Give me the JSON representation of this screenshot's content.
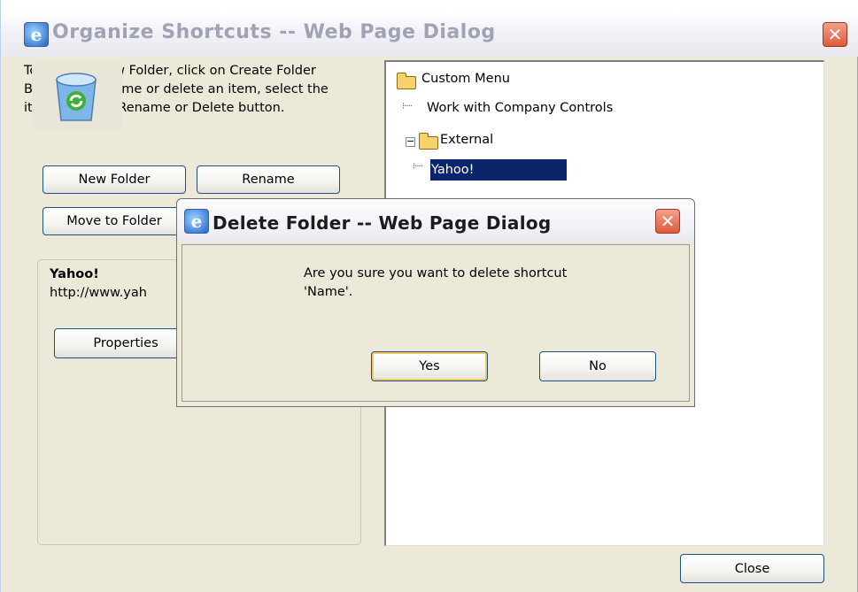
{
  "main_window": {
    "title": "Organize Shortcuts -- Web Page Dialog",
    "instructions": "To create a new Folder, click on Create Folder Button. To rename or delete an item, select the item and click Rename or Delete button.",
    "buttons": {
      "new_folder": "New Folder",
      "rename": "Rename",
      "move_to_folder": "Move to Folder",
      "properties": "Properties",
      "close": "Close"
    },
    "selected_info": {
      "name": "Yahoo!",
      "url": "http://www.yah"
    },
    "tree": {
      "root": "Custom Menu",
      "items": [
        "Work with Company Controls",
        "External",
        "Yahoo!"
      ],
      "selected": "Yahoo!"
    }
  },
  "delete_dialog": {
    "title": "Delete Folder -- Web Page Dialog",
    "message_line1": "Are you sure you want to delete shortcut",
    "message_line2": "'Name'.",
    "yes_label": "Yes",
    "no_label": "No"
  },
  "icons": {
    "window": "ie-icon",
    "close": "close-icon",
    "folder": "folder-icon",
    "recycle": "recycle-bin-icon"
  },
  "colors": {
    "window_bg": "#ece9d8",
    "selection": "#0a246a",
    "close_button": "#de5a3d"
  }
}
